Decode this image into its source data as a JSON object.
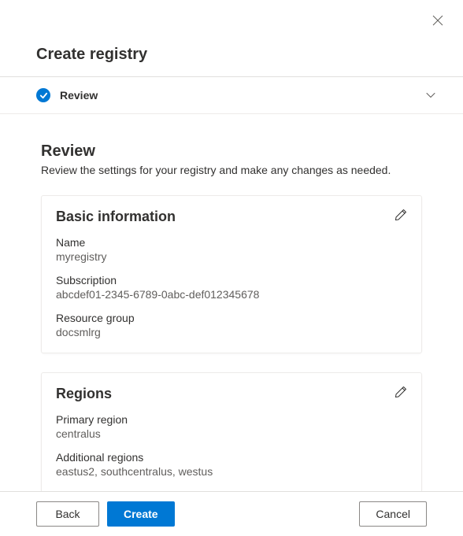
{
  "header": {
    "title": "Create registry"
  },
  "step": {
    "label": "Review"
  },
  "review": {
    "heading": "Review",
    "description": "Review the settings for your registry and make any changes as needed."
  },
  "basic_info": {
    "title": "Basic information",
    "name_label": "Name",
    "name_value": "myregistry",
    "subscription_label": "Subscription",
    "subscription_value": "abcdef01-2345-6789-0abc-def012345678",
    "resource_group_label": "Resource group",
    "resource_group_value": "docsmlrg"
  },
  "regions": {
    "title": "Regions",
    "primary_label": "Primary region",
    "primary_value": "centralus",
    "additional_label": "Additional regions",
    "additional_value": "eastus2, southcentralus, westus"
  },
  "footer": {
    "back": "Back",
    "create": "Create",
    "cancel": "Cancel"
  }
}
